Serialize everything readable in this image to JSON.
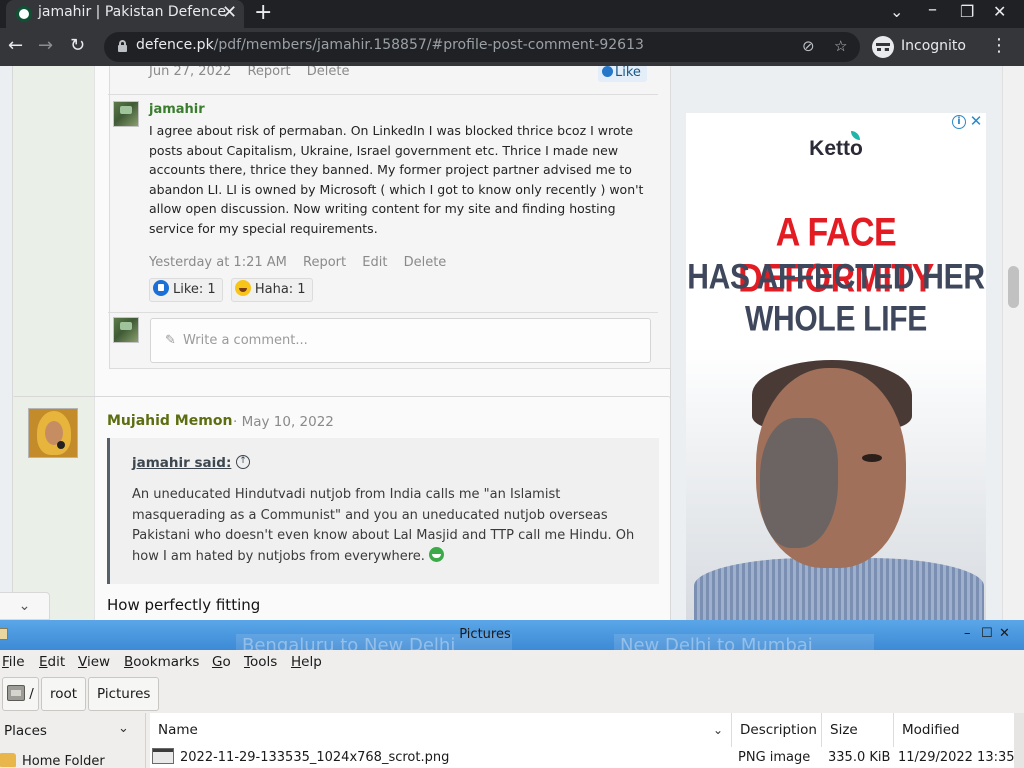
{
  "browser": {
    "tab_title": "jamahir | Pakistan Defence",
    "url_host": "defence.pk",
    "url_path": "/pdf/members/jamahir.158857/#profile-post-comment-92613",
    "incognito_label": "Incognito"
  },
  "thread": {
    "prev_meta": {
      "date": "Jun 27, 2022",
      "report": "Report",
      "delete": "Delete",
      "like": "Like"
    },
    "comment": {
      "author": "jamahir",
      "text": "I agree about risk of permaban. On LinkedIn I was blocked thrice bcoz I wrote posts about Capitalism, Ukraine, Israel government etc. Thrice I made new accounts there, thrice they banned. My former project partner advised me to abandon LI. LI is owned by Microsoft ( which I got to know only recently ) won't allow open discussion. Now writing content for my site and finding hosting service for my special requirements.",
      "time": "Yesterday at 1:21 AM",
      "report": "Report",
      "edit": "Edit",
      "delete": "Delete",
      "reactions": [
        {
          "icon": "like-reaction-icon",
          "label": "Like: 1"
        },
        {
          "icon": "haha-reaction-icon",
          "label": "Haha: 1"
        }
      ]
    },
    "comment_placeholder": "Write a comment..."
  },
  "post": {
    "author": "Mujahid Memon",
    "date": "· May 10, 2022",
    "quote_head": "jamahir said:",
    "quote_text": "An uneducated Hindutvadi nutjob from India calls me \"an Islamist masquerading as a Communist\" and you an uneducated nutjob overseas Pakistani who doesn't even know about Lal Masjid and TTP call me Hindu. Oh how I am hated by nutjobs from everywhere.",
    "text": "How perfectly fitting"
  },
  "ad": {
    "brand": "Ketto",
    "headline": "A FACE DEFORMITY",
    "line2": "HAS AFFECTED HER",
    "line3": "WHOLE LIFE"
  },
  "file_manager": {
    "title": "Pictures",
    "ghost_left": "Bengaluru to New Delhi",
    "ghost_right": "New Delhi to Mumbai",
    "menus": [
      "File",
      "Edit",
      "View",
      "Bookmarks",
      "Go",
      "Tools",
      "Help"
    ],
    "path": {
      "root_sep": "/",
      "seg1": "root",
      "seg2": "Pictures"
    },
    "places_label": "Places",
    "home_folder": "Home Folder",
    "columns": {
      "name": "Name",
      "description": "Description",
      "size": "Size",
      "modified": "Modified"
    },
    "row": {
      "name": "2022-11-29-133535_1024x768_scrot.png",
      "description": "PNG image",
      "size": "335.0 KiB",
      "modified": "11/29/2022 13:35"
    }
  }
}
